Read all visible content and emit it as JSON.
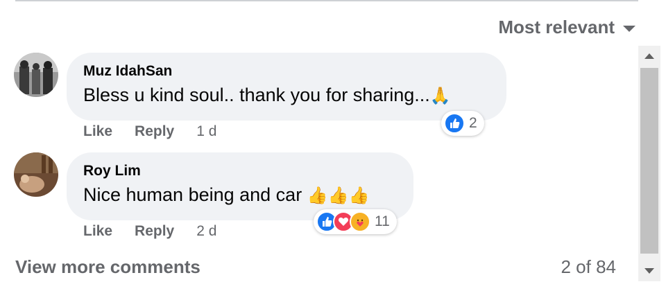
{
  "sort": {
    "label": "Most relevant",
    "icon": "caret-down-icon"
  },
  "comments": [
    {
      "author": "Muz IdahSan",
      "text": "Bless u kind soul.. thank you for sharing...",
      "emoji": "🙏",
      "actions": {
        "like": "Like",
        "reply": "Reply",
        "time": "1 d"
      },
      "reactions": {
        "icons": [
          "like-icon"
        ],
        "count": "2"
      }
    },
    {
      "author": "Roy Lim",
      "text": "Nice human being and car",
      "emoji": "👍👍👍",
      "actions": {
        "like": "Like",
        "reply": "Reply",
        "time": "2 d"
      },
      "reactions": {
        "icons": [
          "like-icon",
          "love-icon",
          "care-icon"
        ],
        "count": "11"
      }
    }
  ],
  "footer": {
    "view_more": "View more comments",
    "pager": "2 of 84"
  },
  "colors": {
    "like_blue": "#1877f2",
    "love_red": "#f33e58",
    "care_yellow": "#f7b125",
    "secondary_text": "#65676b",
    "bubble": "#f0f2f5"
  }
}
